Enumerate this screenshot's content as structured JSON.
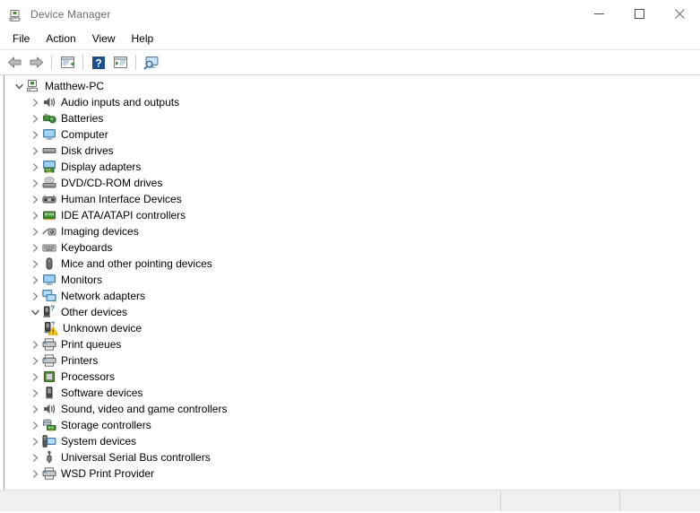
{
  "window": {
    "title": "Device Manager",
    "icon": "device-manager-icon",
    "controls": {
      "minimize": "minimize-icon",
      "maximize": "maximize-icon",
      "close": "close-icon"
    }
  },
  "menubar": {
    "items": [
      {
        "label": "File"
      },
      {
        "label": "Action"
      },
      {
        "label": "View"
      },
      {
        "label": "Help"
      }
    ]
  },
  "toolbar": {
    "buttons": [
      {
        "name": "back-button",
        "icon": "back-arrow-icon"
      },
      {
        "name": "forward-button",
        "icon": "forward-arrow-icon"
      },
      {
        "name": "separator-1",
        "icon": "separator"
      },
      {
        "name": "properties-button",
        "icon": "properties-icon"
      },
      {
        "name": "separator-2",
        "icon": "separator"
      },
      {
        "name": "help-button",
        "icon": "help-question-icon"
      },
      {
        "name": "show-hidden-button",
        "icon": "show-hidden-devices-icon"
      },
      {
        "name": "separator-3",
        "icon": "separator"
      },
      {
        "name": "scan-hardware-button",
        "icon": "scan-for-hardware-changes-icon"
      }
    ]
  },
  "tree": {
    "nodes": [
      {
        "label": "Matthew-PC",
        "level": 0,
        "state": "expanded",
        "icon": "computer-root-icon"
      },
      {
        "label": "Audio inputs and outputs",
        "level": 1,
        "state": "collapsed",
        "icon": "speaker-icon"
      },
      {
        "label": "Batteries",
        "level": 1,
        "state": "collapsed",
        "icon": "battery-icon"
      },
      {
        "label": "Computer",
        "level": 1,
        "state": "collapsed",
        "icon": "monitor-icon"
      },
      {
        "label": "Disk drives",
        "level": 1,
        "state": "collapsed",
        "icon": "disk-drive-icon"
      },
      {
        "label": "Display adapters",
        "level": 1,
        "state": "collapsed",
        "icon": "display-adapter-icon"
      },
      {
        "label": "DVD/CD-ROM drives",
        "level": 1,
        "state": "collapsed",
        "icon": "optical-drive-icon"
      },
      {
        "label": "Human Interface Devices",
        "level": 1,
        "state": "collapsed",
        "icon": "hid-icon"
      },
      {
        "label": "IDE ATA/ATAPI controllers",
        "level": 1,
        "state": "collapsed",
        "icon": "ide-controller-icon"
      },
      {
        "label": "Imaging devices",
        "level": 1,
        "state": "collapsed",
        "icon": "imaging-device-icon"
      },
      {
        "label": "Keyboards",
        "level": 1,
        "state": "collapsed",
        "icon": "keyboard-icon"
      },
      {
        "label": "Mice and other pointing devices",
        "level": 1,
        "state": "collapsed",
        "icon": "mouse-icon"
      },
      {
        "label": "Monitors",
        "level": 1,
        "state": "collapsed",
        "icon": "monitor-icon"
      },
      {
        "label": "Network adapters",
        "level": 1,
        "state": "collapsed",
        "icon": "network-adapter-icon"
      },
      {
        "label": "Other devices",
        "level": 1,
        "state": "expanded",
        "icon": "unknown-device-icon"
      },
      {
        "label": "Unknown device",
        "level": 2,
        "state": "leaf",
        "icon": "unknown-device-warning-icon"
      },
      {
        "label": "Print queues",
        "level": 1,
        "state": "collapsed",
        "icon": "printer-icon"
      },
      {
        "label": "Printers",
        "level": 1,
        "state": "collapsed",
        "icon": "printer-icon"
      },
      {
        "label": "Processors",
        "level": 1,
        "state": "collapsed",
        "icon": "processor-icon"
      },
      {
        "label": "Software devices",
        "level": 1,
        "state": "collapsed",
        "icon": "software-device-icon"
      },
      {
        "label": "Sound, video and game controllers",
        "level": 1,
        "state": "collapsed",
        "icon": "speaker-icon"
      },
      {
        "label": "Storage controllers",
        "level": 1,
        "state": "collapsed",
        "icon": "storage-controller-icon"
      },
      {
        "label": "System devices",
        "level": 1,
        "state": "collapsed",
        "icon": "system-device-icon"
      },
      {
        "label": "Universal Serial Bus controllers",
        "level": 1,
        "state": "collapsed",
        "icon": "usb-icon"
      },
      {
        "label": "WSD Print Provider",
        "level": 1,
        "state": "collapsed",
        "icon": "printer-icon"
      }
    ]
  },
  "statusbar": {
    "pane1": "",
    "pane2": "",
    "pane3": ""
  },
  "colors": {
    "window_background": "#ffffff",
    "title_text": "#6b6b6b",
    "text": "#000000",
    "chevron": "#868686",
    "statusbar_background": "#f0f0f0",
    "border": "#d4d4d4",
    "warning_yellow": "#ffd119",
    "accent_blue": "#3a8fd4",
    "green": "#3f9b35"
  }
}
